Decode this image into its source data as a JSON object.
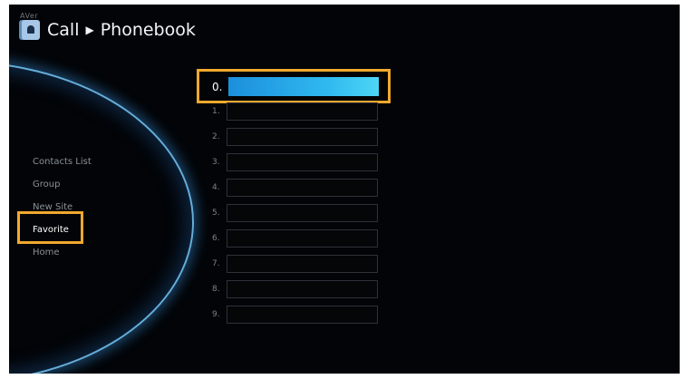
{
  "brand": "AVer",
  "header": {
    "section": "Call",
    "page": "Phonebook"
  },
  "nav": {
    "items": [
      {
        "label": "Contacts List"
      },
      {
        "label": "Group"
      },
      {
        "label": "New Site"
      },
      {
        "label": "Favorite"
      },
      {
        "label": "Home"
      }
    ],
    "selected": "Favorite"
  },
  "favorites": {
    "slots": [
      {
        "number": "0.",
        "value": ""
      },
      {
        "number": "1.",
        "value": ""
      },
      {
        "number": "2.",
        "value": ""
      },
      {
        "number": "3.",
        "value": ""
      },
      {
        "number": "4.",
        "value": ""
      },
      {
        "number": "5.",
        "value": ""
      },
      {
        "number": "6.",
        "value": ""
      },
      {
        "number": "7.",
        "value": ""
      },
      {
        "number": "8.",
        "value": ""
      },
      {
        "number": "9.",
        "value": ""
      }
    ],
    "selected_index": 0
  },
  "colors": {
    "background": "#020407",
    "focus_border": "#f0a92e",
    "selection_start": "#1c8fdc",
    "selection_end": "#4dd6f6",
    "arc_glow": "#78cdff"
  },
  "icons": {
    "header": "phonebook-icon",
    "separator": "breadcrumb-arrow-icon"
  }
}
